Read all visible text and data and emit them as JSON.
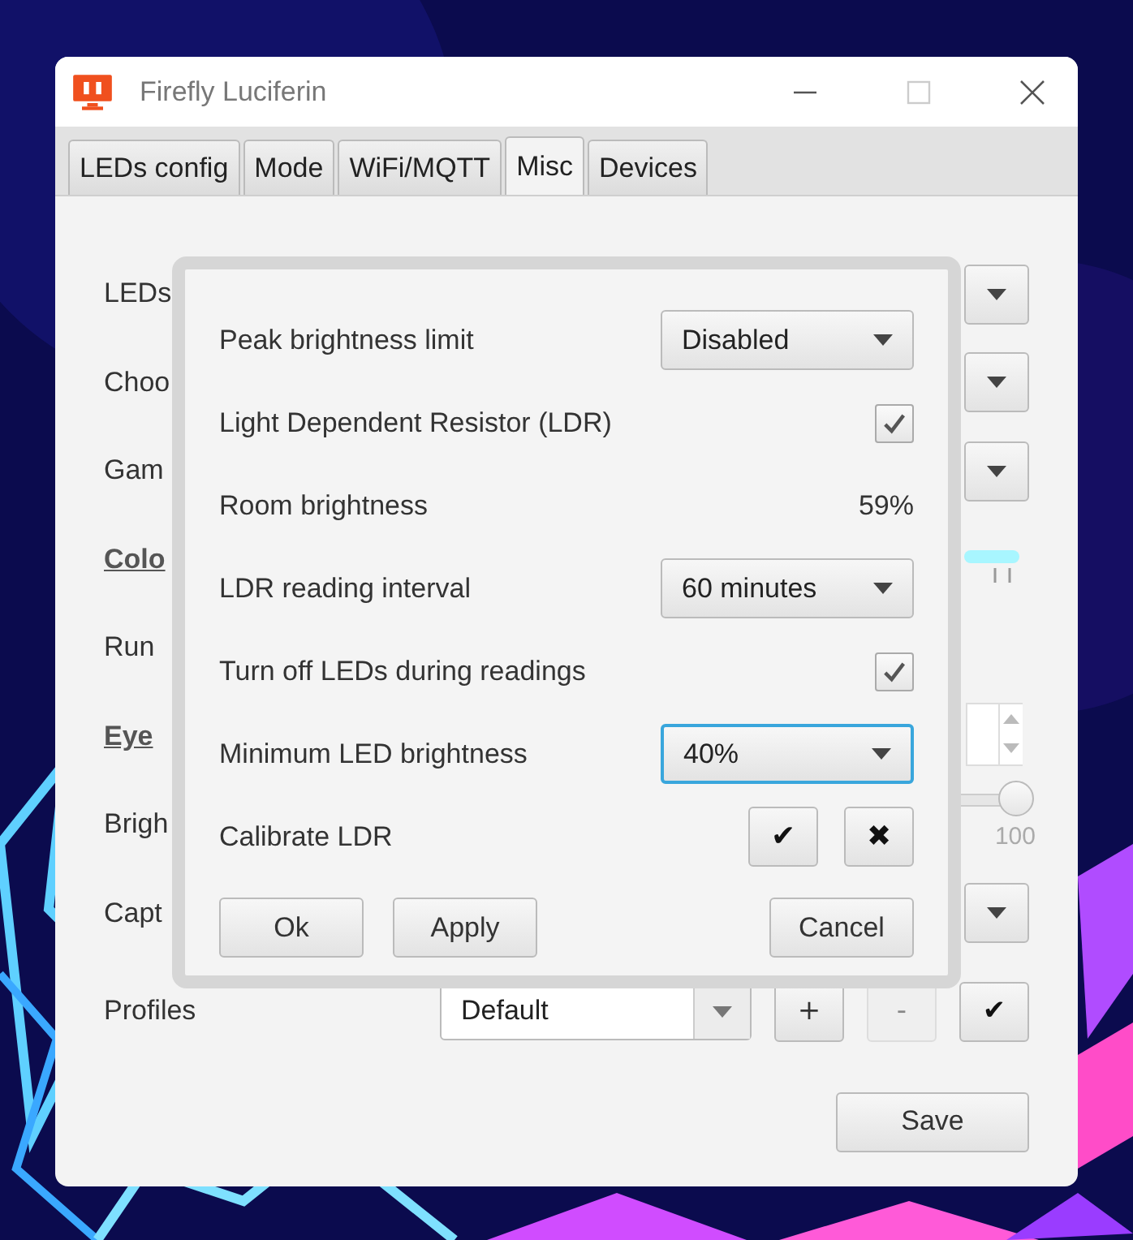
{
  "window": {
    "title": "Firefly Luciferin"
  },
  "tabs": [
    {
      "label": "LEDs config",
      "selected": false
    },
    {
      "label": "Mode",
      "selected": false
    },
    {
      "label": "WiFi/MQTT",
      "selected": false
    },
    {
      "label": "Misc",
      "selected": true
    },
    {
      "label": "Devices",
      "selected": false
    }
  ],
  "settings": [
    {
      "label": "LEDs",
      "kind": "combo",
      "heading": false
    },
    {
      "label": "Choo",
      "kind": "combo",
      "heading": false
    },
    {
      "label": "Gam",
      "kind": "combo",
      "heading": false
    },
    {
      "label": "Colo",
      "kind": "bar",
      "heading": true
    },
    {
      "label": "Run",
      "kind": "none",
      "heading": false
    },
    {
      "label": "Eye",
      "kind": "spinner",
      "heading": true
    },
    {
      "label": "Brigh",
      "kind": "slider",
      "heading": false,
      "level": 1,
      "max_label": "100"
    },
    {
      "label": "Capt",
      "kind": "combo",
      "heading": false
    }
  ],
  "profiles": {
    "label": "Profiles",
    "value": "Default",
    "add": "+",
    "remove": "-",
    "remove_disabled": true,
    "confirm": "✔"
  },
  "save": "Save",
  "dialog": {
    "rows": [
      {
        "label": "Peak brightness limit",
        "kind": "combo",
        "value": "Disabled",
        "focused": false
      },
      {
        "label": "Light Dependent Resistor (LDR)",
        "kind": "checkbox",
        "checked": true
      },
      {
        "label": "Room brightness",
        "kind": "reading",
        "value": "59%"
      },
      {
        "label": "LDR reading interval",
        "kind": "combo",
        "value": "60 minutes",
        "focused": false
      },
      {
        "label": "Turn off LEDs during readings",
        "kind": "checkbox",
        "checked": true
      },
      {
        "label": "Minimum LED brightness",
        "kind": "combo",
        "value": "40%",
        "focused": true
      },
      {
        "label": "Calibrate LDR",
        "kind": "buttons",
        "buttons": [
          "✔",
          "✖"
        ]
      }
    ],
    "ok": "Ok",
    "apply": "Apply",
    "cancel": "Cancel"
  }
}
